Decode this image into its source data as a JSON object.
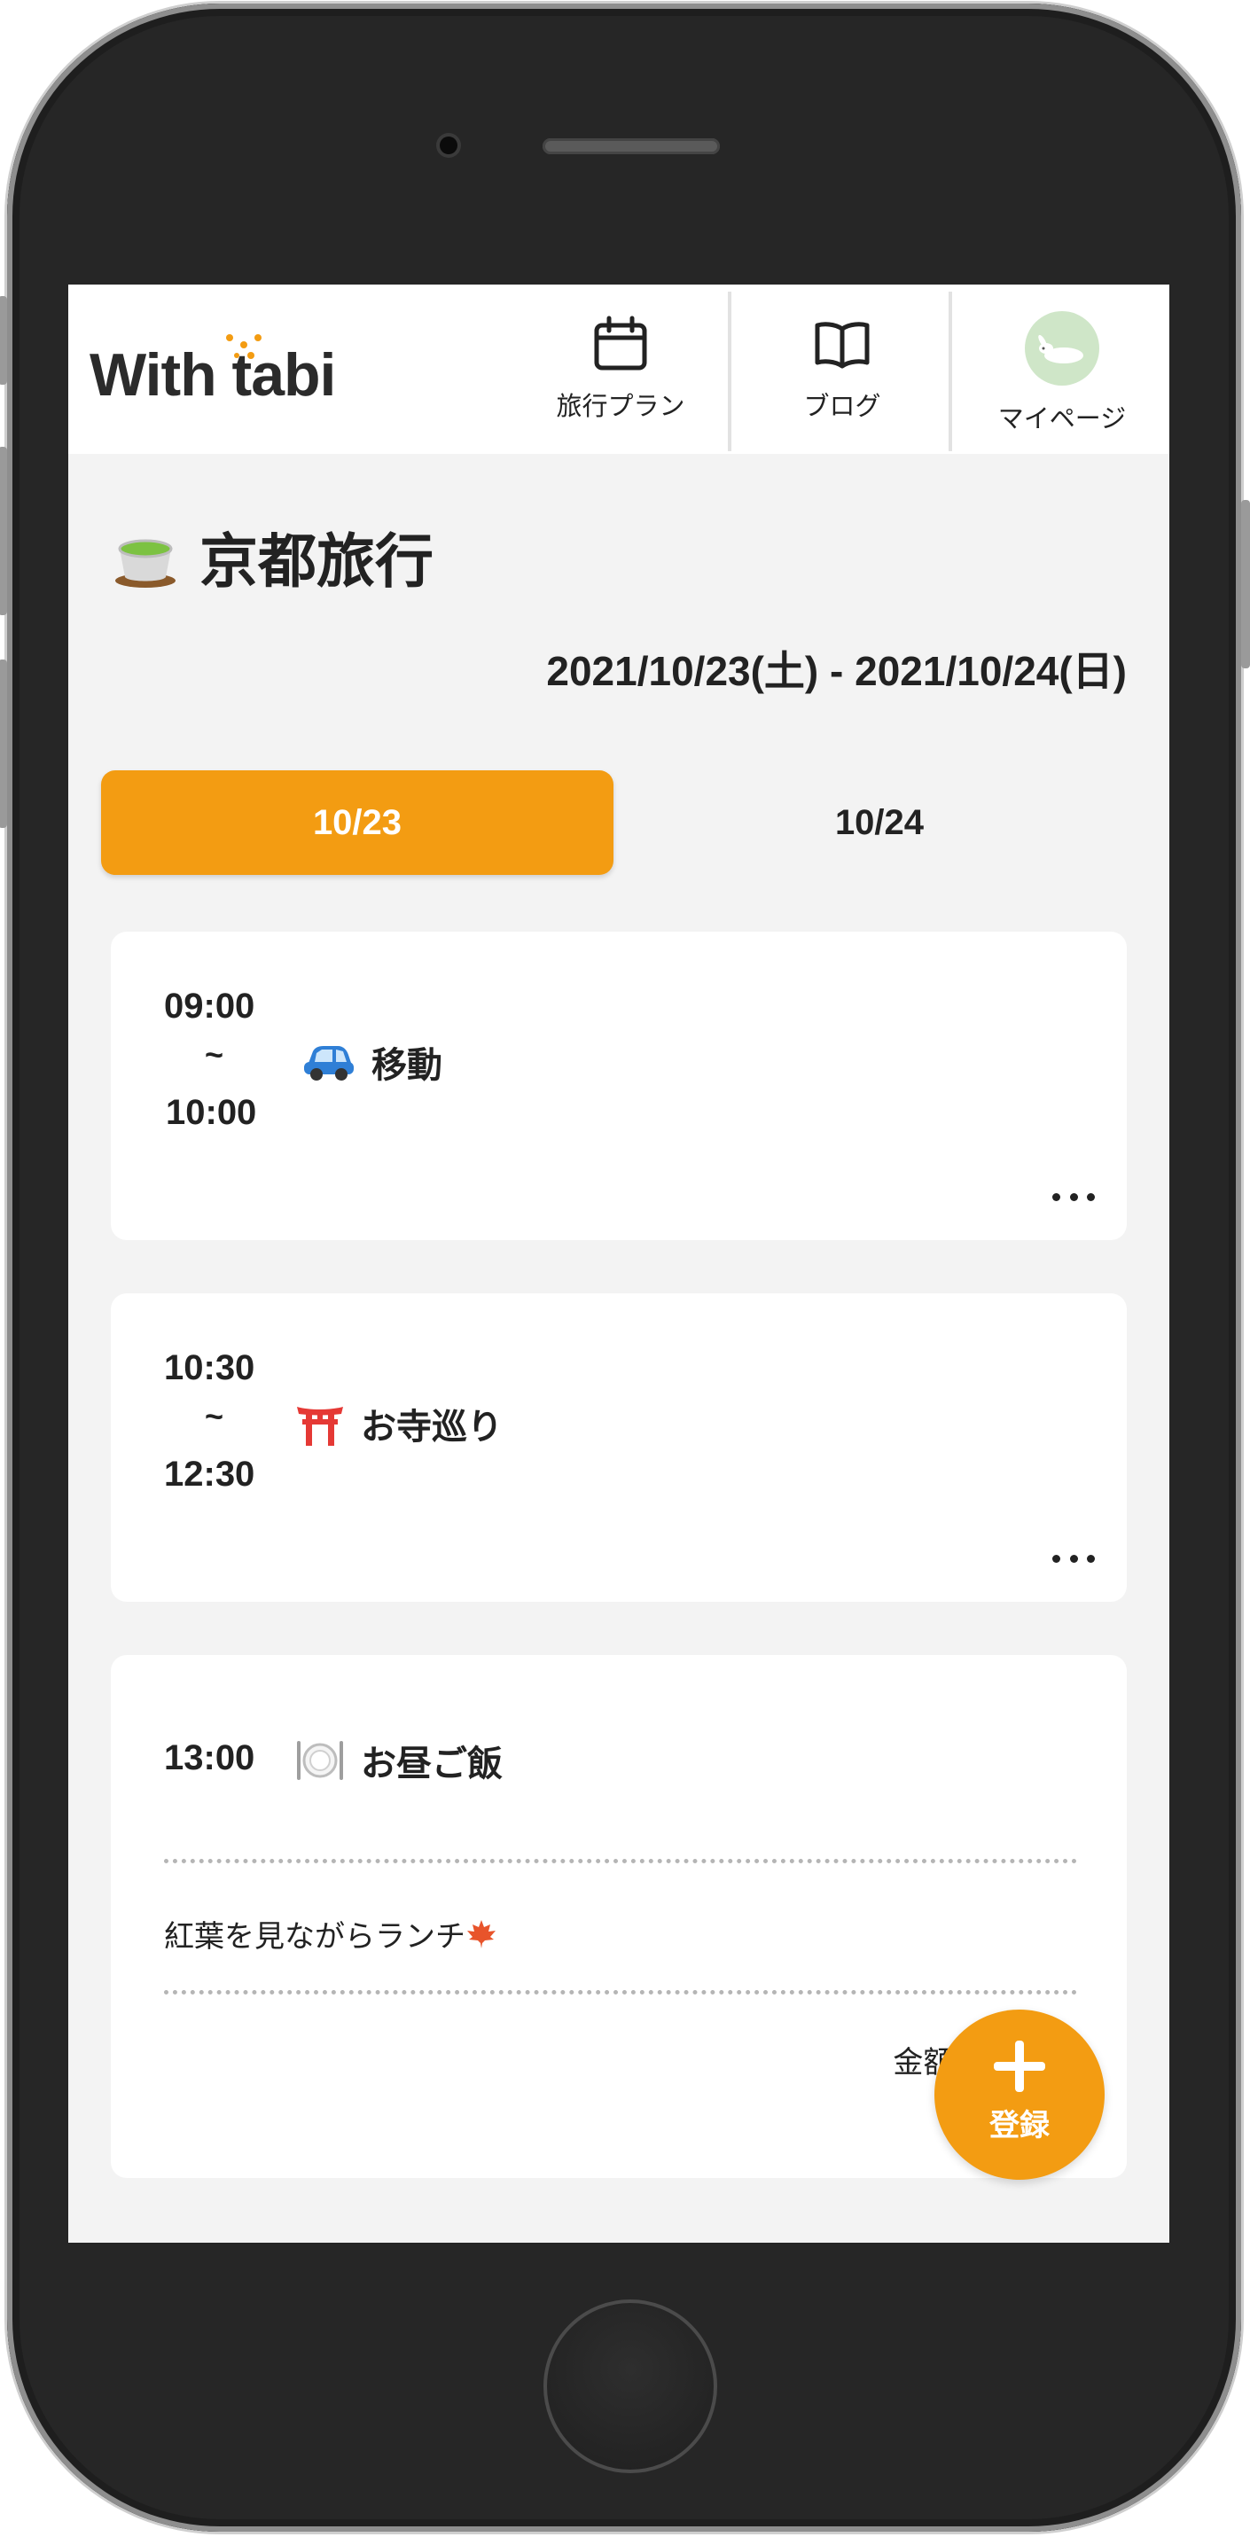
{
  "app": {
    "logo_text": "With tabi"
  },
  "nav": {
    "items": [
      {
        "label": "旅行プラン",
        "icon": "calendar-icon"
      },
      {
        "label": "ブログ",
        "icon": "book-icon"
      },
      {
        "label": "マイページ",
        "icon": "avatar"
      }
    ]
  },
  "trip": {
    "title": "京都旅行",
    "title_icon": "green-tea-icon",
    "date_range": "2021/10/23(土) - 2021/10/24(日)"
  },
  "tabs": [
    {
      "label": "10/23",
      "active": true
    },
    {
      "label": "10/24",
      "active": false
    }
  ],
  "schedule": [
    {
      "start": "09:00",
      "sep": "~",
      "end": "10:00",
      "icon": "car-icon",
      "title": "移動"
    },
    {
      "start": "10:30",
      "sep": "~",
      "end": "12:30",
      "icon": "torii-icon",
      "title": "お寺巡り"
    },
    {
      "start": "13:00",
      "icon": "plate-icon",
      "title": "お昼ご飯",
      "memo": "紅葉を見ながらランチ",
      "memo_icon": "maple-leaf-icon",
      "price_label": "金額：¥"
    }
  ],
  "fab": {
    "label": "登録"
  },
  "colors": {
    "accent": "#f39c12",
    "background": "#f3f3f3",
    "card": "#ffffff"
  }
}
